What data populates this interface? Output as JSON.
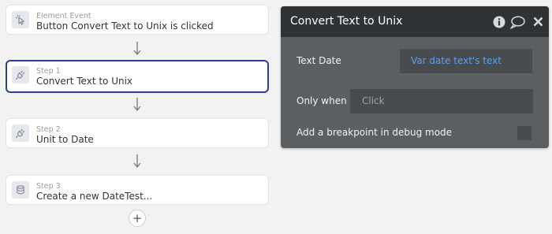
{
  "workflow": {
    "steps": [
      {
        "title": "Element Event",
        "label": "Button Convert Text to Unix is clicked",
        "icon": "cursor-click-icon"
      },
      {
        "title": "Step 1",
        "label": "Convert Text to Unix",
        "icon": "plugin-icon",
        "selected": true
      },
      {
        "title": "Step 2",
        "label": "Unit to Date",
        "icon": "plugin-icon"
      },
      {
        "title": "Step 3",
        "label": "Create a new DateTest...",
        "icon": "database-icon"
      }
    ],
    "add_step_symbol": "+"
  },
  "panel": {
    "title": "Convert Text to Unix",
    "header_icons": [
      "info-icon",
      "comment-icon",
      "close-icon"
    ],
    "fields": {
      "text_date": {
        "label": "Text Date",
        "value": "Var date text's text"
      },
      "only_when": {
        "label": "Only when",
        "placeholder": "Click"
      },
      "breakpoint": {
        "label": "Add a breakpoint in debug mode",
        "checked": false
      }
    }
  },
  "colors": {
    "selected_border": "#2c3f8f",
    "panel_bg": "#5b5f62",
    "panel_header_bg": "#2f3336",
    "dynamic_value": "#5fa0e8",
    "placeholder": "#a0a4a7"
  }
}
